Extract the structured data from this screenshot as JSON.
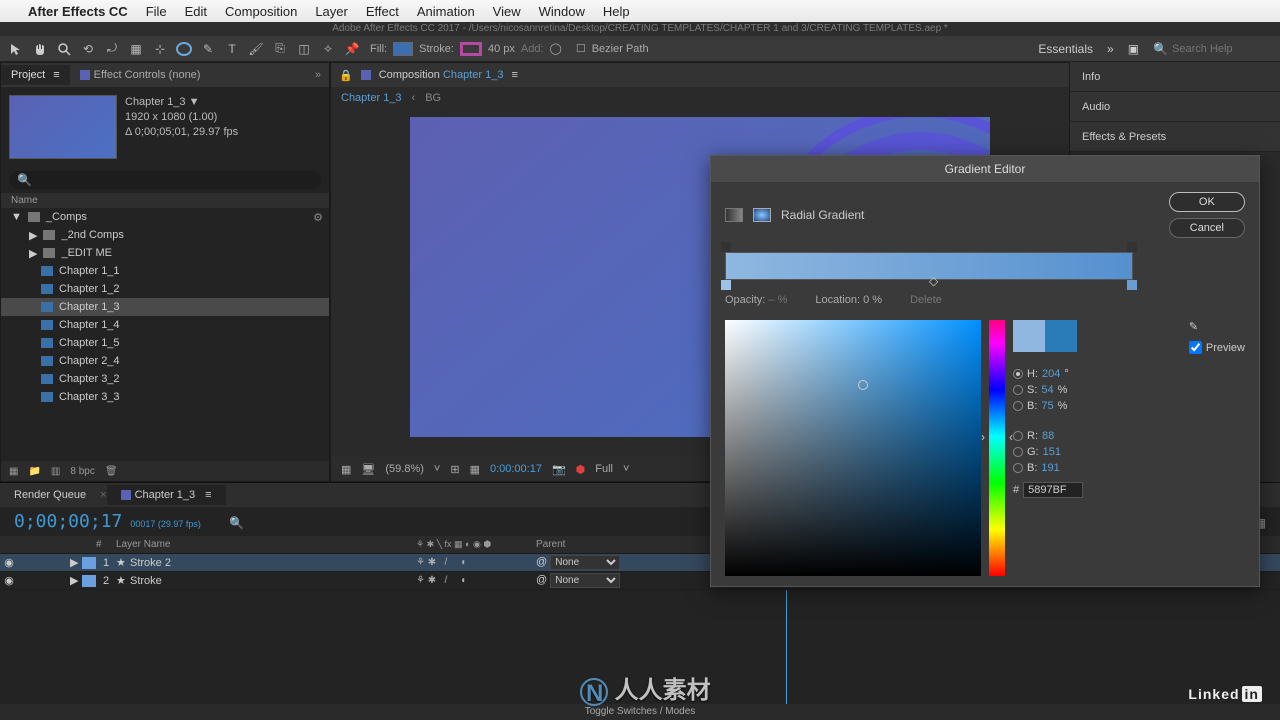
{
  "mac_menu": {
    "app": "After Effects CC",
    "items": [
      "File",
      "Edit",
      "Composition",
      "Layer",
      "Effect",
      "Animation",
      "View",
      "Window",
      "Help"
    ]
  },
  "title_bar": "Adobe After Effects CC 2017 - /Users/nicosannretina/Desktop/CREATING TEMPLATES/CHAPTER 1 and 3/CREATING TEMPLATES.aep *",
  "toolbar": {
    "fill_label": "Fill:",
    "stroke_label": "Stroke:",
    "stroke_width": "40 px",
    "add_label": "Add:",
    "bezier_label": "Bezier Path",
    "workspace": "Essentials",
    "search_placeholder": "Search Help"
  },
  "panels": {
    "project_tab": "Project",
    "effect_controls_tab": "Effect Controls (none)"
  },
  "project": {
    "comp_name": "Chapter 1_3 ▼",
    "resolution": "1920 x 1080 (1.00)",
    "duration": "Δ 0;00;05;01, 29.97 fps",
    "name_col": "Name",
    "tree": {
      "root": "_Comps",
      "sub1": "_2nd Comps",
      "sub2": "_EDIT ME",
      "items": [
        "Chapter 1_1",
        "Chapter 1_2",
        "Chapter 1_3",
        "Chapter 1_4",
        "Chapter 1_5",
        "Chapter 2_4",
        "Chapter 3_2",
        "Chapter 3_3"
      ]
    },
    "footer_bpc": "8 bpc"
  },
  "composition": {
    "tab_prefix": "Composition",
    "tab_name": "Chapter 1_3",
    "breadcrumb_current": "Chapter 1_3",
    "breadcrumb_bg": "BG",
    "zoom": "(59.8%)",
    "timecode": "0:00:00:17",
    "resolution_menu": "Full"
  },
  "right_panels": [
    "Info",
    "Audio",
    "Effects & Presets"
  ],
  "timeline": {
    "render_queue_tab": "Render Queue",
    "comp_tab": "Chapter 1_3",
    "timecode": "0;00;00;17",
    "frame_info": "00017 (29.97 fps)",
    "cols": {
      "num": "#",
      "name": "Layer Name",
      "parent": "Parent"
    },
    "layers": [
      {
        "num": "1",
        "name": "Stroke 2",
        "parent": "None",
        "color": "#6aa0e0"
      },
      {
        "num": "2",
        "name": "Stroke",
        "parent": "None",
        "color": "#6aa0e0"
      }
    ],
    "footer": "Toggle Switches / Modes"
  },
  "gradient_editor": {
    "title": "Gradient Editor",
    "type_label": "Radial Gradient",
    "ok": "OK",
    "cancel": "Cancel",
    "opacity_label": "Opacity:",
    "opacity_value": "– %",
    "location_label": "Location:",
    "location_value": "0 %",
    "delete_label": "Delete",
    "preview_label": "Preview",
    "color": {
      "h_label": "H:",
      "h": "204",
      "h_unit": "°",
      "s_label": "S:",
      "s": "54",
      "s_unit": "%",
      "b_label": "B:",
      "b": "75",
      "b_unit": "%",
      "r_label": "R:",
      "r": "88",
      "g_label": "G:",
      "g": "151",
      "bl_label": "B:",
      "bl": "191",
      "hex_label": "#",
      "hex": "5897BF",
      "current": "#8fb7e0",
      "new": "#2a7cb8"
    }
  },
  "branding": {
    "linkedin": "Linked",
    "in": "in",
    "watermark": "人人素材"
  }
}
